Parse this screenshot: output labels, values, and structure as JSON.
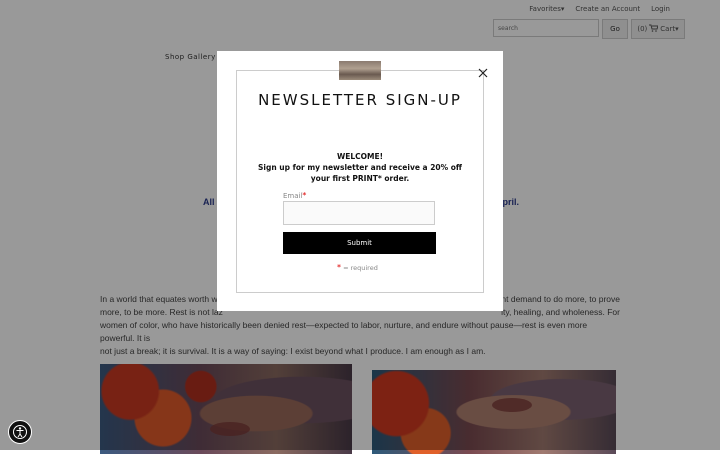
{
  "header": {
    "nav": [
      "Favorites▾",
      "Create an Account",
      "Login"
    ],
    "search_placeholder": "search",
    "go_label": "Go",
    "cart_label": "(0)",
    "cart_text": "Cart▾"
  },
  "shop_nav": "Shop Gallery",
  "highlight": {
    "left": "All",
    "right": "pril."
  },
  "body_lines": [
    "In a world that equates worth w",
    "nt demand to do more, to prove",
    "more, to be more. Rest is not laz",
    "ity, healing, and wholeness. For",
    "women of color, who have historically been denied rest—expected to labor, nurture, and endure without pause—rest is even more powerful. It is",
    "not just a break; it is survival. It is a way of saying: I exist beyond what I produce. I am enough as I am."
  ],
  "modal": {
    "title": "NEWSLETTER SIGN-UP",
    "welcome": "WELCOME!",
    "line1": "Sign up for my newsletter and receive a 20% off",
    "line2": "your first PRINT* order.",
    "email_label": "Email",
    "asterisk": "*",
    "submit": "Submit",
    "required_note": "= required"
  }
}
